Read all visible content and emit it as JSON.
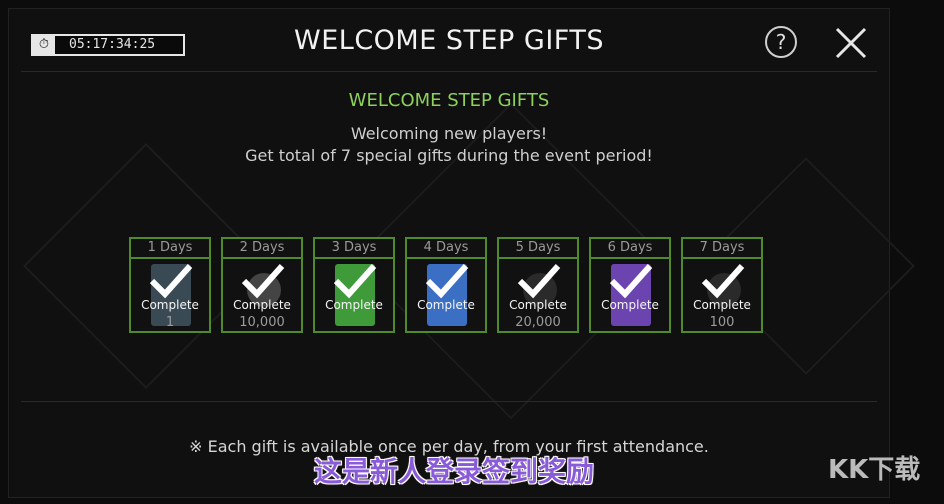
{
  "header": {
    "timer": "05:17:34:25",
    "title": "WELCOME STEP GIFTS",
    "help_label": "?"
  },
  "content": {
    "subtitle": "WELCOME STEP GIFTS",
    "line1": "Welcoming new players!",
    "line2": "Get total of 7 special gifts during the event period!"
  },
  "days": [
    {
      "label": "1 Days",
      "status": "Complete",
      "amount": "1",
      "reward_color": "#3a4a55"
    },
    {
      "label": "2 Days",
      "status": "Complete",
      "amount": "10,000",
      "reward_color": "#444444"
    },
    {
      "label": "3 Days",
      "status": "Complete",
      "amount": "",
      "reward_color": "#3f9a3a"
    },
    {
      "label": "4 Days",
      "status": "Complete",
      "amount": "",
      "reward_color": "#3b6fc4"
    },
    {
      "label": "5 Days",
      "status": "Complete",
      "amount": "20,000",
      "reward_color": "#2a2a2a"
    },
    {
      "label": "6 Days",
      "status": "Complete",
      "amount": "",
      "reward_color": "#6c44b0"
    },
    {
      "label": "7 Days",
      "status": "Complete",
      "amount": "100",
      "reward_color": "#2a2a2a"
    }
  ],
  "footer": {
    "note": "※ Each gift is available once per day, from your first attendance."
  },
  "overlay": {
    "caption": "这是新人登录签到奖励",
    "logo": "KK下载"
  }
}
